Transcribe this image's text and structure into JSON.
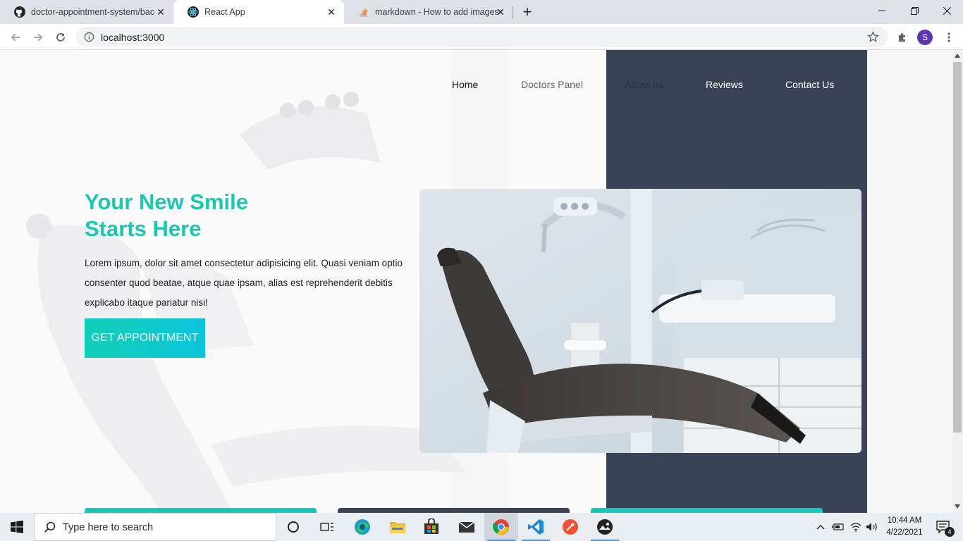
{
  "browser": {
    "tabs": [
      {
        "title": "doctor-appointment-system/bac",
        "icon": "github-icon",
        "active": false
      },
      {
        "title": "React App",
        "icon": "react-icon",
        "active": true
      },
      {
        "title": "markdown - How to add images",
        "icon": "stackoverflow-icon",
        "active": false
      }
    ],
    "new_tab_symbol": "+",
    "address": "localhost:3000",
    "profile_initial": "S"
  },
  "nav": {
    "links": [
      "Home",
      "Doctors Panel",
      "About us",
      "Reviews",
      "Contact Us"
    ]
  },
  "hero": {
    "title_line1": "Your New Smile",
    "title_line2": "Starts Here",
    "text": "Lorem ipsum, dolor sit amet consectetur adipisicing elit. Quasi veniam optio consenter quod beatae, atque quae ipsam, alias est reprehenderit debitis explicabo itaque pariatur nisi!",
    "cta_label": "GET APPOINTMENT",
    "image_icon": "dental-chair-image"
  },
  "colors": {
    "accent": "#1cc7b0",
    "dark_panel": "#3a4256",
    "cta_gradient_start": "#11cfb8",
    "cta_gradient_end": "#0cc4da"
  },
  "taskbar": {
    "search_placeholder": "Type here to search",
    "apps": [
      "task-view-icon",
      "widgets-icon",
      "edge-icon",
      "file-explorer-icon",
      "store-icon",
      "mail-icon",
      "chrome-icon",
      "vscode-icon",
      "git-icon",
      "photos-icon"
    ],
    "time": "10:44 AM",
    "date": "4/22/2021",
    "notification_count": "4"
  }
}
